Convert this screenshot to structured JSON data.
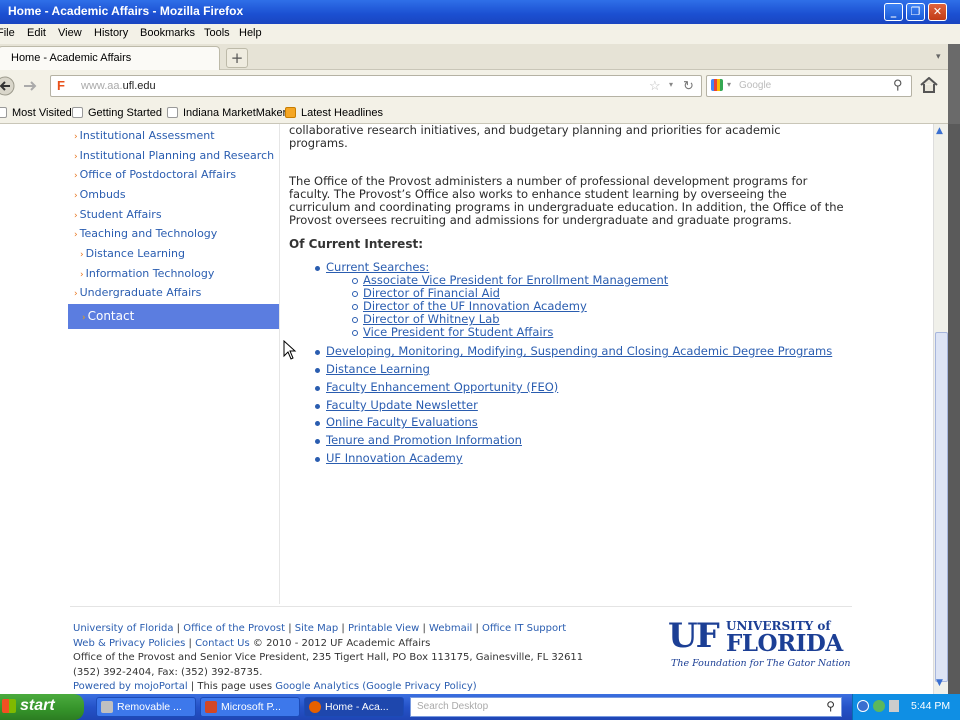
{
  "window": {
    "title": "Home - Academic Affairs - Mozilla Firefox"
  },
  "menu": [
    "File",
    "Edit",
    "View",
    "History",
    "Bookmarks",
    "Tools",
    "Help"
  ],
  "tab": {
    "label": "Home - Academic Affairs",
    "new_tab": "+"
  },
  "address": {
    "prefix": "www.aa.",
    "domain": "ufl.edu"
  },
  "search": {
    "placeholder": "Google"
  },
  "bookmarks": [
    "Most Visited",
    "Getting Started",
    "Indiana MarketMaker",
    "Latest Headlines"
  ],
  "sidebar": {
    "items": [
      "Institutional Assessment",
      "Institutional Planning and Research",
      "Office of Postdoctoral Affairs",
      "Ombuds",
      "Student Affairs",
      "Teaching and Technology",
      "Distance Learning",
      "Information Technology",
      "Undergraduate Affairs"
    ],
    "contact": "Contact"
  },
  "content": {
    "para1_line1": "collaborative research initiatives, and budgetary planning and priorities for academic",
    "para1_line2": "programs.",
    "para2": "The Office of the Provost administers a number of professional development programs for faculty. The Provost’s Office also works to enhance student learning by overseeing the curriculum and coordinating programs in undergraduate education.  In addition, the Office of the Provost oversees recruiting and admissions for undergraduate and graduate programs.",
    "interest_heading": "Of Current Interest:",
    "current_searches": "Current Searches:",
    "searches": [
      "Associate Vice President for Enrollment Management",
      "Director of Financial Aid",
      "Director of the UF Innovation Academy",
      "Director of Whitney Lab",
      "Vice President for Student Affairs"
    ],
    "links": [
      "Developing, Monitoring, Modifying, Suspending and Closing Academic Degree Programs",
      "Distance Learning",
      "Faculty Enhancement Opportunity (FEO)",
      "Faculty Update Newsletter",
      "Online Faculty Evaluations",
      "Tenure and Promotion Information",
      "UF Innovation Academy"
    ]
  },
  "footer": {
    "links1": [
      "University of Florida",
      "Office of the Provost",
      "Site Map",
      "Printable View",
      "Webmail",
      "Office IT Support"
    ],
    "links2a": "Web & Privacy Policies",
    "links2b": "Contact Us",
    "copyright": "© 2010 - 2012 UF Academic Affairs",
    "address": "Office of the Provost and Senior Vice President, 235 Tigert Hall, PO Box 113175, Gainesville, FL 32611",
    "phone": "(352) 392-2404, Fax: (352) 392-8735.",
    "powered_by": "Powered by mojoPortal",
    "analytics_text": "This page uses",
    "analytics_link": "Google Analytics",
    "privacy_link": "(Google Privacy Policy)"
  },
  "logo": {
    "uf": "UF",
    "university": "UNIVERSITY of",
    "florida": "FLORIDA",
    "tagline": "The Foundation for The Gator Nation"
  },
  "taskbar": {
    "start": "start",
    "tasks": [
      "Removable ...",
      "Microsoft P...",
      "Home - Aca..."
    ],
    "search_placeholder": "Search Desktop",
    "clock": "5:44 PM"
  }
}
